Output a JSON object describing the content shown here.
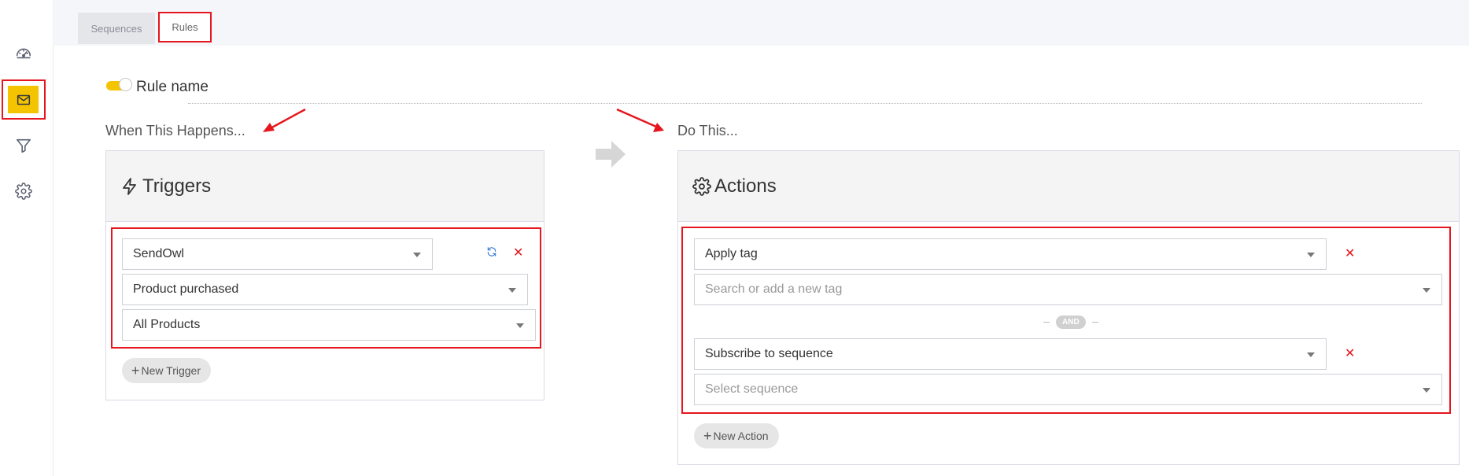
{
  "sidebar": {
    "items": [
      {
        "icon": "dashboard-icon"
      },
      {
        "icon": "mail-icon",
        "active": true
      },
      {
        "icon": "filter-icon"
      },
      {
        "icon": "settings-icon"
      }
    ]
  },
  "tabs": [
    {
      "label": "Sequences"
    },
    {
      "label": "Rules",
      "active": true
    }
  ],
  "rule": {
    "name_label": "Rule name",
    "enabled": true
  },
  "when": {
    "label": "When This Happens...",
    "panel_title": "Triggers",
    "trigger": {
      "source": "SendOwl",
      "event": "Product purchased",
      "product": "All Products"
    },
    "new_button": "New Trigger"
  },
  "do": {
    "label": "Do This...",
    "panel_title": "Actions",
    "actions": [
      {
        "type": "Apply tag",
        "detail_placeholder": "Search or add a new tag"
      },
      {
        "type": "Subscribe to sequence",
        "detail_placeholder": "Select sequence"
      }
    ],
    "separator": "AND",
    "new_button": "New Action"
  },
  "colors": {
    "accent": "#f5c400",
    "highlight": "#e5161d",
    "link": "#3a7bd5"
  }
}
